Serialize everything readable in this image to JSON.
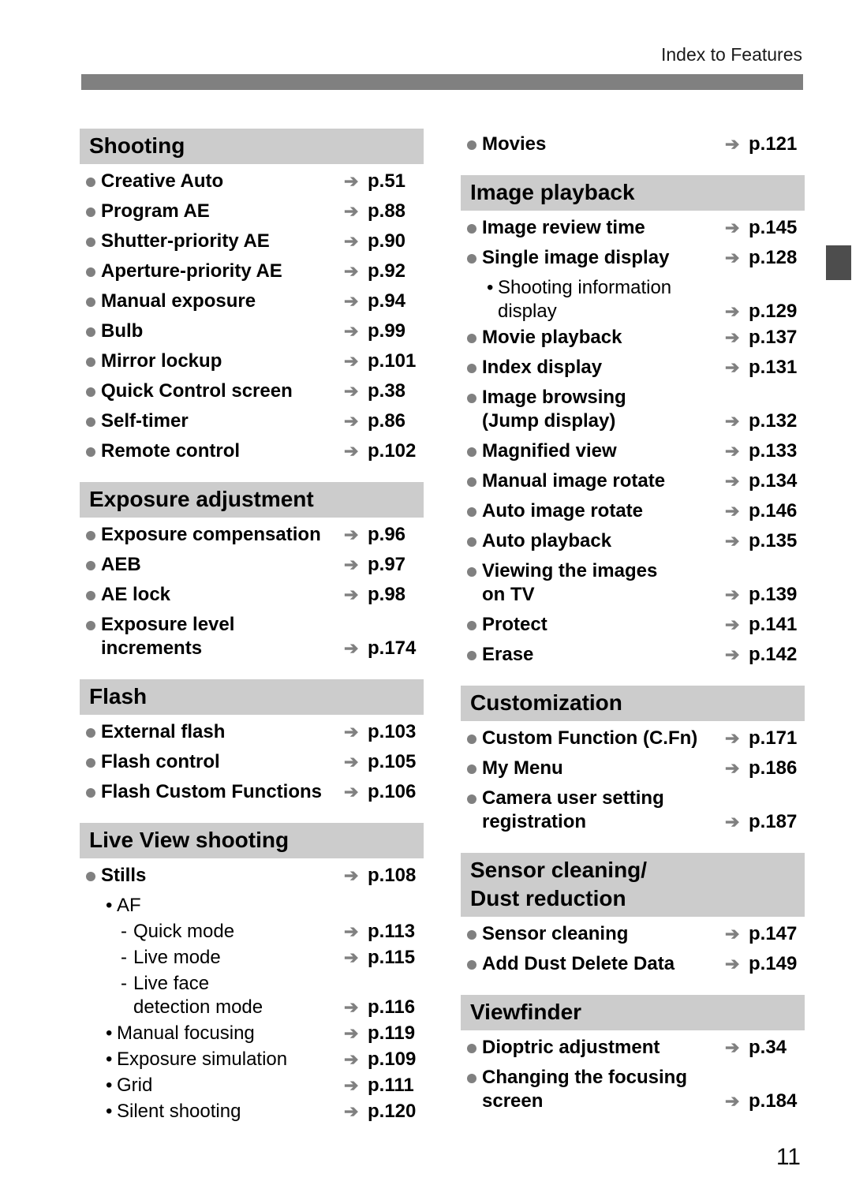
{
  "running_head": "Index to Features",
  "page_number": "11",
  "arrow_glyph": "➔",
  "colors": {
    "top_bar": "#808080",
    "section_header_bg": "#cccccc",
    "bullet": "#808080",
    "arrow": "#808080",
    "side_tab": "#4d4d4d"
  },
  "left_column": [
    {
      "title": "Shooting",
      "entries": [
        {
          "level": 0,
          "label": "Creative Auto",
          "page": "p.51"
        },
        {
          "level": 0,
          "label": "Program AE",
          "page": "p.88"
        },
        {
          "level": 0,
          "label": "Shutter-priority AE",
          "page": "p.90"
        },
        {
          "level": 0,
          "label": "Aperture-priority AE",
          "page": "p.92"
        },
        {
          "level": 0,
          "label": "Manual exposure",
          "page": "p.94"
        },
        {
          "level": 0,
          "label": "Bulb",
          "page": "p.99"
        },
        {
          "level": 0,
          "label": "Mirror lockup",
          "page": "p.101"
        },
        {
          "level": 0,
          "label": "Quick Control screen",
          "page": "p.38"
        },
        {
          "level": 0,
          "label": "Self-timer",
          "page": "p.86"
        },
        {
          "level": 0,
          "label": "Remote control",
          "page": "p.102"
        }
      ]
    },
    {
      "title": "Exposure adjustment",
      "entries": [
        {
          "level": 0,
          "label": "Exposure compensation",
          "page": "p.96"
        },
        {
          "level": 0,
          "label": "AEB",
          "page": "p.97"
        },
        {
          "level": 0,
          "label": "AE lock",
          "page": "p.98"
        },
        {
          "level": 0,
          "label": "Exposure level\nincrements",
          "page": "p.174"
        }
      ]
    },
    {
      "title": "Flash",
      "entries": [
        {
          "level": 0,
          "label": "External flash",
          "page": "p.103"
        },
        {
          "level": 0,
          "label": "Flash control",
          "page": "p.105"
        },
        {
          "level": 0,
          "label": "Flash Custom Functions",
          "page": "p.106"
        }
      ]
    },
    {
      "title": "Live View shooting",
      "entries": [
        {
          "level": 0,
          "label": "Stills",
          "page": "p.108"
        },
        {
          "level": 1,
          "label": "AF",
          "page": ""
        },
        {
          "level": 2,
          "label": "Quick mode",
          "page": "p.113"
        },
        {
          "level": 2,
          "label": "Live mode",
          "page": "p.115"
        },
        {
          "level": 2,
          "label": "Live face\ndetection mode",
          "page": "p.116"
        },
        {
          "level": 1,
          "label": "Manual focusing",
          "page": "p.119"
        },
        {
          "level": 1,
          "label": "Exposure simulation",
          "page": "p.109"
        },
        {
          "level": 1,
          "label": "Grid",
          "page": "p.111"
        },
        {
          "level": 1,
          "label": "Silent shooting",
          "page": "p.120"
        }
      ]
    }
  ],
  "right_column": [
    {
      "title": "",
      "entries": [
        {
          "level": 0,
          "label": "Movies",
          "page": "p.121"
        }
      ]
    },
    {
      "title": "Image playback",
      "entries": [
        {
          "level": 0,
          "label": "Image review time",
          "page": "p.145"
        },
        {
          "level": 0,
          "label": "Single image display",
          "page": "p.128"
        },
        {
          "level": 1,
          "label": "Shooting information\ndisplay",
          "page": "p.129"
        },
        {
          "level": 0,
          "label": "Movie playback",
          "page": "p.137"
        },
        {
          "level": 0,
          "label": "Index display",
          "page": "p.131"
        },
        {
          "level": 0,
          "label": "Image browsing\n(Jump display)",
          "page": "p.132"
        },
        {
          "level": 0,
          "label": "Magnified view",
          "page": "p.133"
        },
        {
          "level": 0,
          "label": "Manual image rotate",
          "page": "p.134"
        },
        {
          "level": 0,
          "label": "Auto image rotate",
          "page": "p.146"
        },
        {
          "level": 0,
          "label": "Auto playback",
          "page": "p.135"
        },
        {
          "level": 0,
          "label": "Viewing the images\non TV",
          "page": "p.139"
        },
        {
          "level": 0,
          "label": "Protect",
          "page": "p.141"
        },
        {
          "level": 0,
          "label": "Erase",
          "page": "p.142"
        }
      ]
    },
    {
      "title": "Customization",
      "entries": [
        {
          "level": 0,
          "label": "Custom Function (C.Fn)",
          "page": "p.171"
        },
        {
          "level": 0,
          "label": "My Menu",
          "page": "p.186"
        },
        {
          "level": 0,
          "label": "Camera user setting\nregistration",
          "page": "p.187"
        }
      ]
    },
    {
      "title": "Sensor cleaning/\nDust reduction",
      "entries": [
        {
          "level": 0,
          "label": "Sensor cleaning",
          "page": "p.147"
        },
        {
          "level": 0,
          "label": "Add Dust Delete Data",
          "page": "p.149"
        }
      ]
    },
    {
      "title": "Viewfinder",
      "entries": [
        {
          "level": 0,
          "label": "Dioptric adjustment",
          "page": "p.34"
        },
        {
          "level": 0,
          "label": "Changing the focusing\nscreen",
          "page": "p.184"
        }
      ]
    }
  ]
}
